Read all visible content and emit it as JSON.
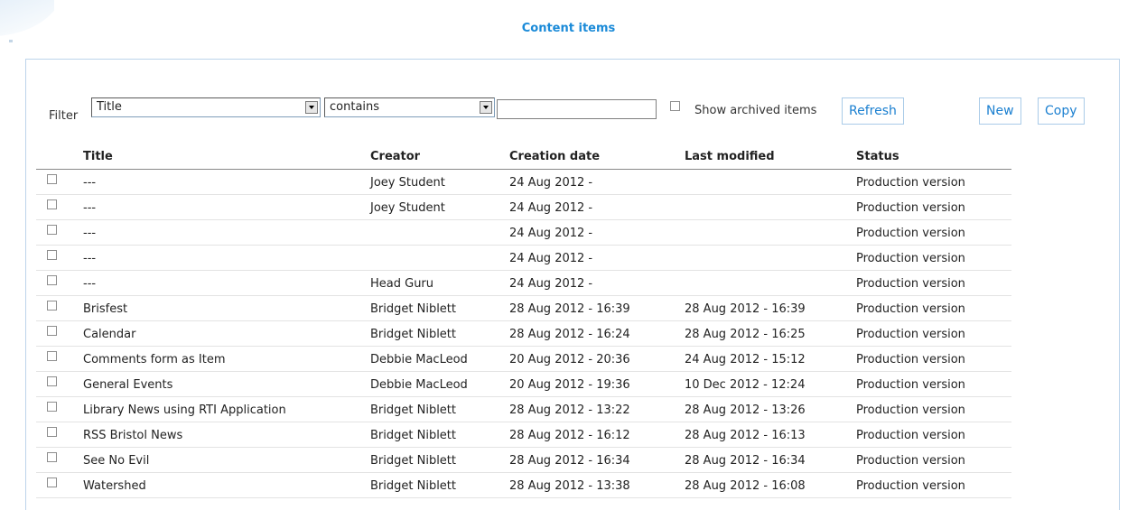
{
  "header": {
    "title": "Content items"
  },
  "filter": {
    "label": "Filter",
    "field_value": "Title",
    "operator_value": "contains",
    "search_value": "",
    "show_archived_label": "Show archived items",
    "refresh_label": "Refresh",
    "new_label": "New",
    "copy_label": "Copy"
  },
  "table": {
    "columns": [
      "Title",
      "Creator",
      "Creation date",
      "Last modified",
      "Status"
    ],
    "rows": [
      {
        "title": "---",
        "creator": "Joey Student",
        "created": "24 Aug 2012 -",
        "modified": "",
        "status": "Production version"
      },
      {
        "title": "---",
        "creator": "Joey Student",
        "created": "24 Aug 2012 -",
        "modified": "",
        "status": "Production version"
      },
      {
        "title": "---",
        "creator": "",
        "created": "24 Aug 2012 -",
        "modified": "",
        "status": "Production version"
      },
      {
        "title": "---",
        "creator": "",
        "created": "24 Aug 2012 -",
        "modified": "",
        "status": "Production version"
      },
      {
        "title": "---",
        "creator": "Head Guru",
        "created": "24 Aug 2012 -",
        "modified": "",
        "status": "Production version"
      },
      {
        "title": "Brisfest",
        "creator": "Bridget Niblett",
        "created": "28 Aug 2012 - 16:39",
        "modified": "28 Aug 2012 - 16:39",
        "status": "Production version"
      },
      {
        "title": "Calendar",
        "creator": "Bridget Niblett",
        "created": "28 Aug 2012 - 16:24",
        "modified": "28 Aug 2012 - 16:25",
        "status": "Production version"
      },
      {
        "title": "Comments form as Item",
        "creator": "Debbie MacLeod",
        "created": "20 Aug 2012 - 20:36",
        "modified": "24 Aug 2012 - 15:12",
        "status": "Production version"
      },
      {
        "title": "General Events",
        "creator": "Debbie MacLeod",
        "created": "20 Aug 2012 - 19:36",
        "modified": "10 Dec 2012 - 12:24",
        "status": "Production version"
      },
      {
        "title": "Library News using RTI Application",
        "creator": "Bridget Niblett",
        "created": "28 Aug 2012 - 13:22",
        "modified": "28 Aug 2012 - 13:26",
        "status": "Production version"
      },
      {
        "title": "RSS Bristol News",
        "creator": "Bridget Niblett",
        "created": "28 Aug 2012 - 16:12",
        "modified": "28 Aug 2012 - 16:13",
        "status": "Production version"
      },
      {
        "title": "See No Evil",
        "creator": "Bridget Niblett",
        "created": "28 Aug 2012 - 16:34",
        "modified": "28 Aug 2012 - 16:34",
        "status": "Production version"
      },
      {
        "title": "Watershed",
        "creator": "Bridget Niblett",
        "created": "28 Aug 2012 - 13:38",
        "modified": "28 Aug 2012 - 16:08",
        "status": "Production version"
      }
    ]
  }
}
